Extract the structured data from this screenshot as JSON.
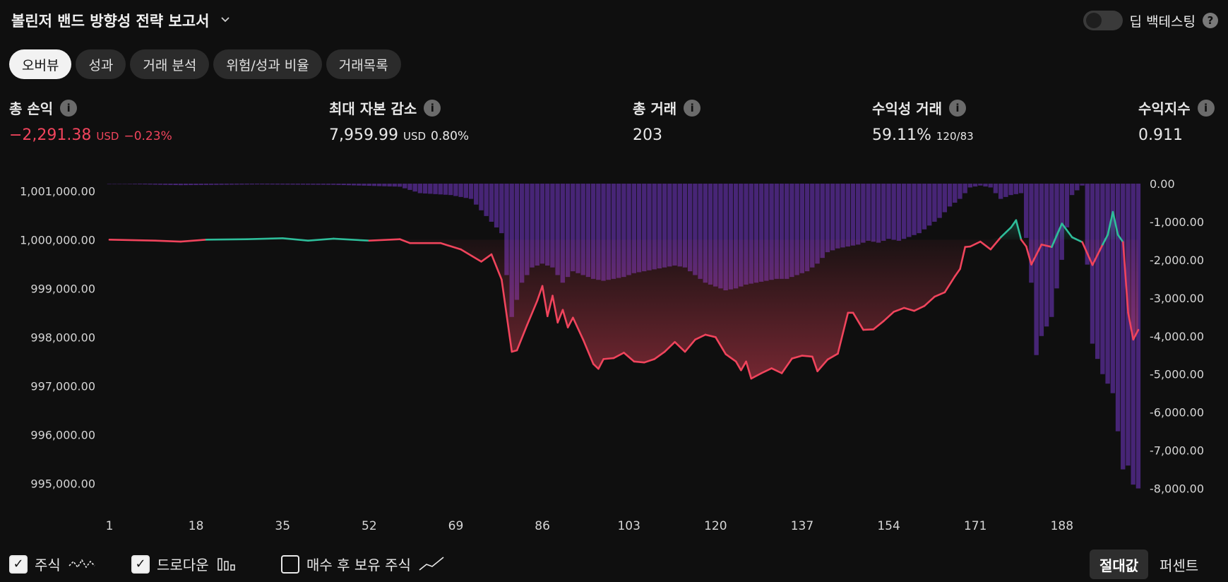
{
  "header": {
    "title": "볼린저 밴드 방향성 전략 보고서",
    "deep_backtest_label": "딥 백테스팅",
    "help": "?"
  },
  "tabs": [
    {
      "label": "오버뷰",
      "active": true
    },
    {
      "label": "성과",
      "active": false
    },
    {
      "label": "거래 분석",
      "active": false
    },
    {
      "label": "위험/성과 비율",
      "active": false
    },
    {
      "label": "거래목록",
      "active": false
    }
  ],
  "metrics": {
    "total_pnl": {
      "label": "총 손익",
      "value": "−2,291.38",
      "unit": "USD",
      "pct": "−0.23%"
    },
    "max_drawdown": {
      "label": "최대 자본 감소",
      "value": "7,959.99",
      "unit": "USD",
      "pct": "0.80%"
    },
    "total_trades": {
      "label": "총 거래",
      "value": "203"
    },
    "profitable_trades": {
      "label": "수익성 거래",
      "value": "59.11%",
      "sub": "120/83"
    },
    "profit_factor": {
      "label": "수익지수",
      "value": "0.911"
    }
  },
  "chart_data": {
    "type": "line",
    "baseline": 1000000,
    "left_axis": {
      "ticks": [
        1001000,
        1000000,
        999000,
        998000,
        997000,
        996000,
        995000
      ],
      "labels": [
        "1,001,000.00",
        "1,000,000.00",
        "999,000.00",
        "998,000.00",
        "997,000.00",
        "996,000.00",
        "995,000.00"
      ],
      "range": [
        994700,
        1001150
      ]
    },
    "right_axis": {
      "ticks": [
        0,
        -1000,
        -2000,
        -3000,
        -4000,
        -5000,
        -6000,
        -7000,
        -8000
      ],
      "labels": [
        "0.00",
        "-1,000.00",
        "-2,000.00",
        "-3,000.00",
        "-4,000.00",
        "-5,000.00",
        "-6,000.00",
        "-7,000.00",
        "-8,000.00"
      ],
      "range": [
        -8250,
        0
      ]
    },
    "x_axis": {
      "ticks": [
        1,
        18,
        35,
        52,
        69,
        86,
        103,
        120,
        137,
        154,
        171,
        188
      ],
      "labels": [
        "1",
        "18",
        "35",
        "52",
        "69",
        "86",
        "103",
        "120",
        "137",
        "154",
        "171",
        "188"
      ],
      "range": [
        1,
        203
      ]
    },
    "equity_points": [
      [
        1,
        1000000
      ],
      [
        10,
        999980
      ],
      [
        15,
        999960
      ],
      [
        20,
        1000000
      ],
      [
        28,
        1000010
      ],
      [
        35,
        1000030
      ],
      [
        40,
        999980
      ],
      [
        45,
        1000020
      ],
      [
        52,
        999980
      ],
      [
        58,
        1000010
      ],
      [
        60,
        999930
      ],
      [
        66,
        999930
      ],
      [
        70,
        999800
      ],
      [
        74,
        999550
      ],
      [
        76,
        999700
      ],
      [
        78,
        999180
      ],
      [
        80,
        997700
      ],
      [
        81,
        997730
      ],
      [
        83,
        998250
      ],
      [
        85,
        998750
      ],
      [
        86,
        999050
      ],
      [
        87,
        998430
      ],
      [
        88,
        998850
      ],
      [
        89,
        998300
      ],
      [
        90,
        998560
      ],
      [
        91,
        998200
      ],
      [
        92,
        998400
      ],
      [
        94,
        997950
      ],
      [
        96,
        997450
      ],
      [
        97,
        997350
      ],
      [
        98,
        997550
      ],
      [
        100,
        997570
      ],
      [
        102,
        997680
      ],
      [
        104,
        997500
      ],
      [
        106,
        997480
      ],
      [
        108,
        997550
      ],
      [
        110,
        997700
      ],
      [
        112,
        997900
      ],
      [
        114,
        997700
      ],
      [
        116,
        997950
      ],
      [
        118,
        998050
      ],
      [
        120,
        998000
      ],
      [
        122,
        997650
      ],
      [
        124,
        997500
      ],
      [
        125,
        997320
      ],
      [
        126,
        997500
      ],
      [
        127,
        997150
      ],
      [
        129,
        997260
      ],
      [
        131,
        997360
      ],
      [
        133,
        997260
      ],
      [
        135,
        997560
      ],
      [
        137,
        997620
      ],
      [
        139,
        997600
      ],
      [
        140,
        997300
      ],
      [
        142,
        997540
      ],
      [
        144,
        997660
      ],
      [
        146,
        998500
      ],
      [
        147,
        998500
      ],
      [
        149,
        998150
      ],
      [
        151,
        998160
      ],
      [
        153,
        998330
      ],
      [
        155,
        998520
      ],
      [
        157,
        998600
      ],
      [
        159,
        998540
      ],
      [
        161,
        998640
      ],
      [
        163,
        998830
      ],
      [
        165,
        998920
      ],
      [
        167,
        999250
      ],
      [
        168,
        999400
      ],
      [
        169,
        999850
      ],
      [
        170,
        999860
      ],
      [
        172,
        999960
      ],
      [
        174,
        999800
      ],
      [
        176,
        1000050
      ],
      [
        177,
        1000150
      ],
      [
        178,
        1000250
      ],
      [
        179,
        1000400
      ],
      [
        180,
        1000000
      ],
      [
        181,
        999860
      ],
      [
        182,
        999490
      ],
      [
        184,
        999900
      ],
      [
        186,
        999850
      ],
      [
        188,
        1000330
      ],
      [
        190,
        1000050
      ],
      [
        192,
        999950
      ],
      [
        194,
        999480
      ],
      [
        196,
        999900
      ],
      [
        197,
        1000100
      ],
      [
        198,
        1000570
      ],
      [
        199,
        1000100
      ],
      [
        200,
        999950
      ],
      [
        201,
        998500
      ],
      [
        202,
        997950
      ],
      [
        203,
        998150
      ]
    ],
    "drawdown_points": [
      [
        1,
        0
      ],
      [
        15,
        -40
      ],
      [
        30,
        -20
      ],
      [
        45,
        -30
      ],
      [
        58,
        -80
      ],
      [
        62,
        -250
      ],
      [
        68,
        -300
      ],
      [
        72,
        -400
      ],
      [
        74,
        -700
      ],
      [
        78,
        -1300
      ],
      [
        80,
        -3500
      ],
      [
        82,
        -2600
      ],
      [
        84,
        -2200
      ],
      [
        86,
        -2100
      ],
      [
        88,
        -2200
      ],
      [
        90,
        -2600
      ],
      [
        92,
        -2300
      ],
      [
        94,
        -2400
      ],
      [
        96,
        -2500
      ],
      [
        98,
        -2550
      ],
      [
        100,
        -2500
      ],
      [
        102,
        -2450
      ],
      [
        104,
        -2350
      ],
      [
        106,
        -2300
      ],
      [
        108,
        -2250
      ],
      [
        110,
        -2200
      ],
      [
        112,
        -2150
      ],
      [
        114,
        -2200
      ],
      [
        116,
        -2400
      ],
      [
        118,
        -2600
      ],
      [
        120,
        -2700
      ],
      [
        122,
        -2800
      ],
      [
        124,
        -2750
      ],
      [
        126,
        -2650
      ],
      [
        128,
        -2600
      ],
      [
        130,
        -2550
      ],
      [
        132,
        -2500
      ],
      [
        134,
        -2500
      ],
      [
        136,
        -2400
      ],
      [
        138,
        -2300
      ],
      [
        140,
        -2100
      ],
      [
        142,
        -1800
      ],
      [
        144,
        -1700
      ],
      [
        146,
        -1650
      ],
      [
        148,
        -1600
      ],
      [
        150,
        -1500
      ],
      [
        152,
        -1550
      ],
      [
        154,
        -1450
      ],
      [
        156,
        -1500
      ],
      [
        158,
        -1400
      ],
      [
        160,
        -1300
      ],
      [
        162,
        -1100
      ],
      [
        164,
        -900
      ],
      [
        166,
        -600
      ],
      [
        168,
        -400
      ],
      [
        170,
        -100
      ],
      [
        172,
        -50
      ],
      [
        174,
        -100
      ],
      [
        176,
        -400
      ],
      [
        178,
        -300
      ],
      [
        180,
        -250
      ],
      [
        182,
        -2600
      ],
      [
        183,
        -4500
      ],
      [
        184,
        -4000
      ],
      [
        186,
        -3500
      ],
      [
        188,
        -2000
      ],
      [
        190,
        -300
      ],
      [
        192,
        -50
      ],
      [
        194,
        -4200
      ],
      [
        196,
        -5000
      ],
      [
        198,
        -5500
      ],
      [
        200,
        -7500
      ],
      [
        201,
        -7400
      ],
      [
        202,
        -7900
      ],
      [
        203,
        -8000
      ]
    ]
  },
  "footer": {
    "stocks": "주식",
    "drawdown": "드로다운",
    "buy_hold": "매수 후 보유 주식",
    "absolute": "절대값",
    "percent": "퍼센트"
  },
  "colors": {
    "profit": "#2ebd9a",
    "loss": "#f0445c",
    "drawdown": "#5b2d9a"
  }
}
